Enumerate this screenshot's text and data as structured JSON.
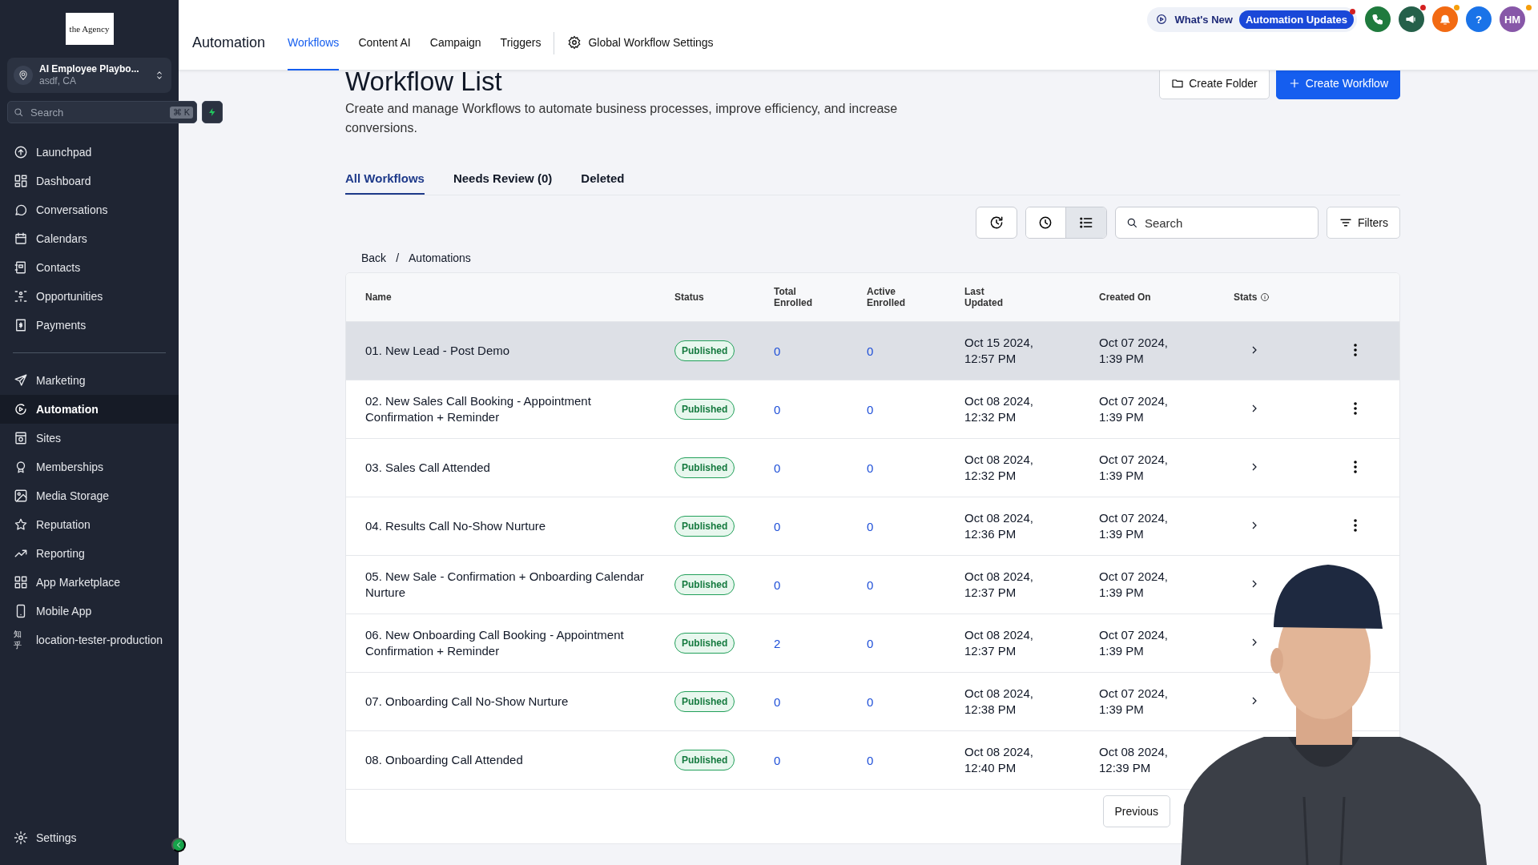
{
  "sidebar": {
    "logo": "the Agency",
    "account": {
      "name": "AI Employee Playbo...",
      "location": "asdf, CA"
    },
    "search": {
      "placeholder": "Search",
      "shortcut": "⌘ K"
    },
    "items": [
      {
        "label": "Launchpad",
        "selected": false
      },
      {
        "label": "Dashboard",
        "selected": false
      },
      {
        "label": "Conversations",
        "selected": false
      },
      {
        "label": "Calendars",
        "selected": false
      },
      {
        "label": "Contacts",
        "selected": false
      },
      {
        "label": "Opportunities",
        "selected": false
      },
      {
        "label": "Payments",
        "selected": false
      },
      {
        "kind": "divider"
      },
      {
        "label": "Marketing",
        "selected": false
      },
      {
        "label": "Automation",
        "selected": true
      },
      {
        "label": "Sites",
        "selected": false
      },
      {
        "label": "Memberships",
        "selected": false
      },
      {
        "label": "Media Storage",
        "selected": false
      },
      {
        "label": "Reputation",
        "selected": false
      },
      {
        "label": "Reporting",
        "selected": false
      },
      {
        "label": "App Marketplace",
        "selected": false
      },
      {
        "label": "Mobile App",
        "selected": false
      },
      {
        "label": "location-tester-production",
        "icon_text": "知乎",
        "selected": false
      }
    ],
    "settings": "Settings"
  },
  "topbar": {
    "title": "Automation",
    "tabs": [
      {
        "label": "Workflows",
        "selected": true
      },
      {
        "label": "Content AI",
        "selected": false
      },
      {
        "label": "Campaign",
        "selected": false
      },
      {
        "label": "Triggers",
        "selected": false
      }
    ],
    "global_settings": "Global Workflow Settings",
    "whats_new": "What's New",
    "updates": "Automation Updates",
    "avatar": "HM",
    "icons": [
      {
        "kind": "phone",
        "color": "#1f7a3d",
        "dot": false
      },
      {
        "kind": "megaphone",
        "color": "#25604a",
        "dot": true
      },
      {
        "kind": "bell",
        "color": "#f26a12",
        "dot": true
      },
      {
        "kind": "help",
        "color": "#1a73e8",
        "dot": false,
        "text": "?"
      }
    ]
  },
  "page": {
    "title": "Workflow List",
    "description": "Create and manage Workflows to automate business processes, improve efficiency, and increase conversions.",
    "create_folder": "Create Folder",
    "create_workflow": "Create Workflow",
    "tabs": [
      {
        "label": "All Workflows",
        "selected": true
      },
      {
        "label": "Needs Review (0)",
        "selected": false
      },
      {
        "label": "Deleted",
        "selected": false
      }
    ],
    "view_toggle": [
      {
        "kind": "clock",
        "selected": false
      },
      {
        "kind": "list",
        "selected": true
      }
    ],
    "search": {
      "placeholder": "Search"
    },
    "filters": "Filters",
    "breadcrumb": {
      "items": [
        "Back",
        "Automations"
      ],
      "separator": "/"
    }
  },
  "table": {
    "columns": [
      "Name",
      "Status",
      "Total Enrolled",
      "Active Enrolled",
      "Last Updated",
      "Created On",
      "Stats"
    ],
    "rows": [
      {
        "name": "01. New Lead - Post Demo",
        "status": "Published",
        "total": "0",
        "active": "0",
        "updated": [
          "Oct 15 2024,",
          "12:57 PM"
        ],
        "created": [
          "Oct 07 2024,",
          "1:39 PM"
        ],
        "selected": true,
        "stats_visible": true,
        "menu_visible": true
      },
      {
        "name": "02. New Sales Call Booking - Appointment Confirmation + Reminder",
        "status": "Published",
        "total": "0",
        "active": "0",
        "updated": [
          "Oct 08 2024,",
          "12:32 PM"
        ],
        "created": [
          "Oct 07 2024,",
          "1:39 PM"
        ],
        "selected": false,
        "stats_visible": true,
        "menu_visible": true
      },
      {
        "name": "03. Sales Call Attended",
        "status": "Published",
        "total": "0",
        "active": "0",
        "updated": [
          "Oct 08 2024,",
          "12:32 PM"
        ],
        "created": [
          "Oct 07 2024,",
          "1:39 PM"
        ],
        "selected": false,
        "stats_visible": true,
        "menu_visible": true
      },
      {
        "name": "04. Results Call No-Show Nurture",
        "status": "Published",
        "total": "0",
        "active": "0",
        "updated": [
          "Oct 08 2024,",
          "12:36 PM"
        ],
        "created": [
          "Oct 07 2024,",
          "1:39 PM"
        ],
        "selected": false,
        "stats_visible": true,
        "menu_visible": true
      },
      {
        "name": "05. New Sale - Confirmation + Onboarding Calendar Nurture",
        "status": "Published",
        "total": "0",
        "active": "0",
        "updated": [
          "Oct 08 2024,",
          "12:37 PM"
        ],
        "created": [
          "Oct 07 2024,",
          "1:39 PM"
        ],
        "selected": false,
        "stats_visible": true,
        "menu_visible": false
      },
      {
        "name": "06. New Onboarding Call Booking - Appointment Confirmation + Reminder",
        "status": "Published",
        "total": "2",
        "active": "0",
        "updated": [
          "Oct 08 2024,",
          "12:37 PM"
        ],
        "created": [
          "Oct 07 2024,",
          "1:39 PM"
        ],
        "selected": false,
        "stats_visible": true,
        "menu_visible": false
      },
      {
        "name": "07. Onboarding Call No-Show Nurture",
        "status": "Published",
        "total": "0",
        "active": "0",
        "updated": [
          "Oct 08 2024,",
          "12:38 PM"
        ],
        "created": [
          "Oct 07 2024,",
          "1:39 PM"
        ],
        "selected": false,
        "stats_visible": true,
        "menu_visible": false
      },
      {
        "name": "08. Onboarding Call Attended",
        "status": "Published",
        "total": "0",
        "active": "0",
        "updated": [
          "Oct 08 2024,",
          "12:40 PM"
        ],
        "created": [
          "Oct 08 2024,",
          "12:39 PM"
        ],
        "selected": false,
        "stats_visible": false,
        "menu_visible": false
      }
    ],
    "previous": "Previous"
  }
}
